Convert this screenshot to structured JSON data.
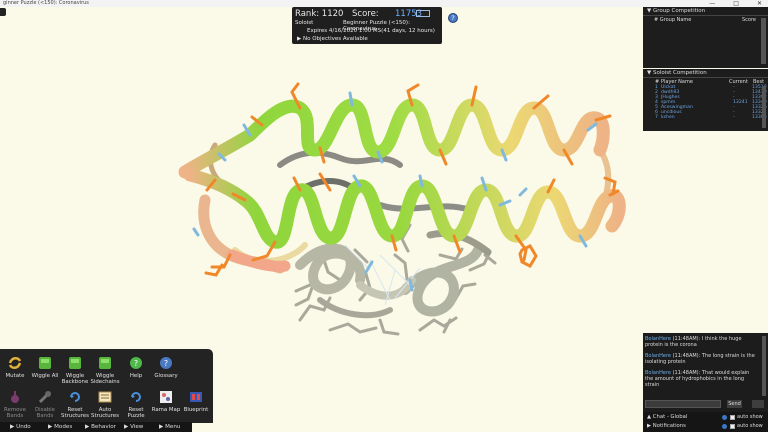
{
  "window": {
    "title": "ginner Puzzle (<150): Coronavirus"
  },
  "score_panel": {
    "rank_text": "Rank: 1120",
    "score_label": "Score:",
    "score_value": "11753",
    "mode": "Soloist",
    "puzzle": "Beginner Puzzle (<150): Coronavirus",
    "expires": "Expires 4/16/2020 1:00 MS(41 days, 12 hours)",
    "objectives": "No Objectives Available",
    "help": "?"
  },
  "group_competition": {
    "title": "Group Competition",
    "col_rank": "# Group Name",
    "col_score": "Score"
  },
  "soloist_competition": {
    "title": "Soloist Competition",
    "col_rank": "#",
    "col_name": "Player Name",
    "col_current": "Current",
    "col_best": "Best",
    "rows": [
      {
        "rank": "1",
        "name": "Ulckat",
        "current": "-",
        "best": "13518"
      },
      {
        "rank": "2",
        "name": "dwdh93",
        "current": "-",
        "best": "13430"
      },
      {
        "rank": "3",
        "name": "JHughes",
        "current": "-",
        "best": "13392"
      },
      {
        "rank": "4",
        "name": "spmm",
        "current": "13241",
        "best": "13349"
      },
      {
        "rank": "5",
        "name": "Aceswingman",
        "current": "-",
        "best": "13326"
      },
      {
        "rank": "6",
        "name": "uncdious",
        "current": "-",
        "best": "13321"
      },
      {
        "rank": "7",
        "name": "kshen",
        "current": "-",
        "best": "13308"
      }
    ]
  },
  "chat": {
    "messages": [
      {
        "author": "BolanHere",
        "time": "(11:48AM):",
        "text": "I think the huge protein is the corona"
      },
      {
        "author": "BolanHere",
        "time": "(11:48AM):",
        "text": "The long strain is the isolating protein"
      },
      {
        "author": "BolanHere",
        "time": "(11:48AM):",
        "text": "That would explain the amount of hydrophobics in the long strain"
      }
    ],
    "send_label": "Send",
    "channel_global": "Chat - Global",
    "channel_notifications": "Notifications",
    "auto_show": "auto show"
  },
  "tools": {
    "row1": [
      "Mutate",
      "Wiggle All",
      "Wiggle Backbone",
      "Wiggle Sidechains",
      "Help",
      "Glossary"
    ],
    "row2": [
      "Remove Bands",
      "Disable Bands",
      "Reset Structures",
      "Auto Structures",
      "Reset Puzzle",
      "Rama Map",
      "Blueprint"
    ]
  },
  "menu": [
    "Undo",
    "Modes",
    "Behavior",
    "View",
    "Menu"
  ],
  "colors": {
    "background": "#fbf9e8",
    "panel": "#1f1f1f",
    "score_accent": "#6db0ff",
    "player_name": "#6ea4e0",
    "chat_author": "#6eaee8",
    "helix_green": "#8fd63c",
    "helix_yellow": "#ecd873",
    "helix_salmon": "#eeb386",
    "sidechain_orange": "#f0882a",
    "sidechain_blue": "#7fb9de",
    "coil_gray": "#9c9c8c"
  }
}
